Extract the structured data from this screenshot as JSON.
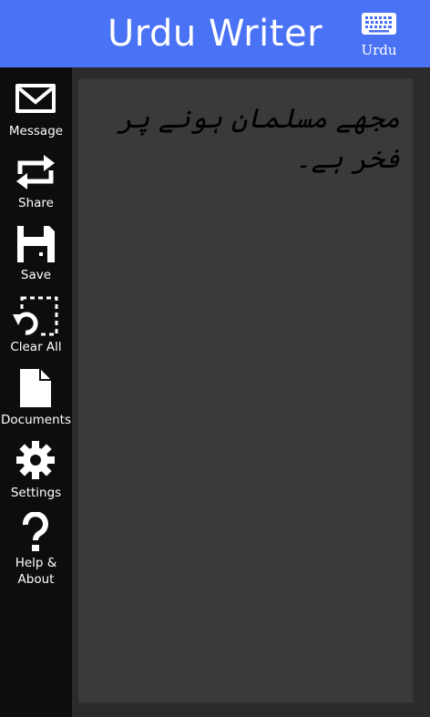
{
  "app": {
    "title": "Urdu Writer"
  },
  "keyboard": {
    "label": "Urdu",
    "icon": "keyboard-icon"
  },
  "sidebar": {
    "items": [
      {
        "label": "Message",
        "icon": "envelope-icon"
      },
      {
        "label": "Share",
        "icon": "share-icon"
      },
      {
        "label": "Save",
        "icon": "save-icon"
      },
      {
        "label": "Clear All",
        "icon": "clear-all-icon"
      },
      {
        "label": "Documents",
        "icon": "document-icon"
      },
      {
        "label": "Settings",
        "icon": "gear-icon"
      },
      {
        "label": "Help &",
        "label_line2": "About",
        "icon": "question-icon"
      }
    ]
  },
  "editor": {
    "text": "مجھے مسلمان ہونے پر فخر ہے۔"
  },
  "colors": {
    "header": "#4a72f5",
    "sidebar": "#0d0d0d",
    "editor_bg": "#3a3a3a",
    "editor_frame": "#2b2b2b",
    "text": "#000000",
    "icon": "#ffffff"
  }
}
